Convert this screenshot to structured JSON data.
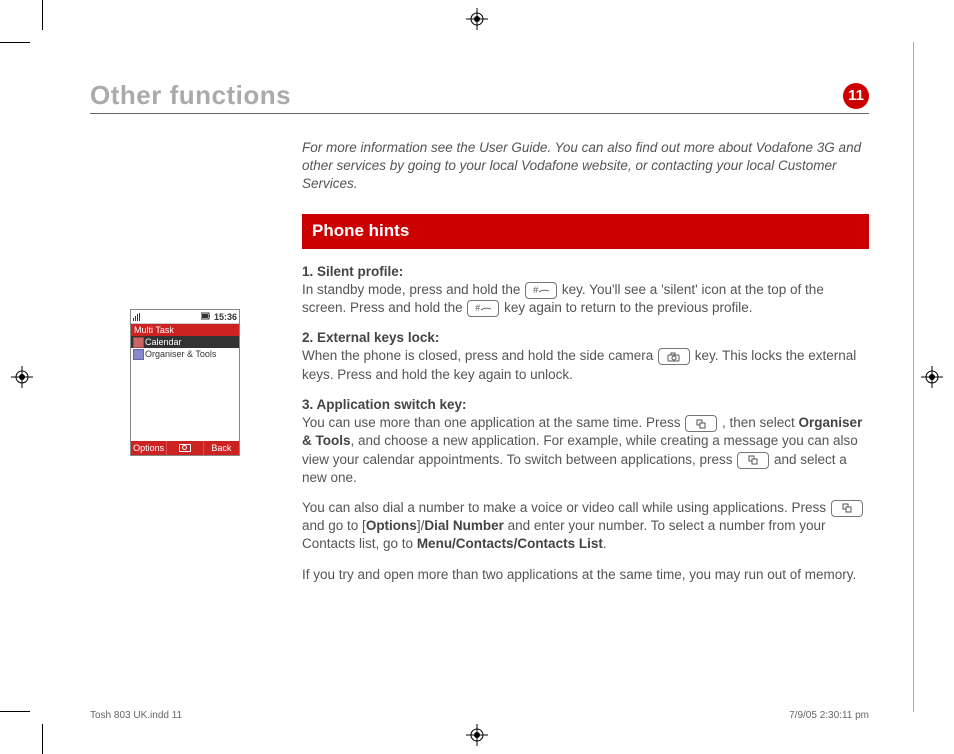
{
  "header": {
    "title": "Other functions",
    "page_number": "11"
  },
  "intro": "For more information see the User Guide. You can also find out more about Vodafone 3G and other services by going to your local Vodafone website, or contacting your local Customer Services.",
  "section_title": "Phone hints",
  "hints": {
    "h1_title": "1. Silent profile:",
    "h1_a": "In standby mode, press and hold the ",
    "h1_b": " key. You'll see a 'silent' icon at the top of the screen. Press and hold the ",
    "h1_c": " key again to return to the previous profile.",
    "h2_title": "2. External keys lock:",
    "h2_a": "When the phone is closed, press and hold the side camera ",
    "h2_b": " key. This locks the external keys. Press and hold the key again to unlock.",
    "h3_title": "3. Application switch key:",
    "h3_a": "You can use more than one application at the same time. Press ",
    "h3_b": " , then select ",
    "h3_b_bold": "Organiser & Tools",
    "h3_c": ", and choose a new application. For example, while creating a message you can also view your calendar appointments. To switch between applications, press ",
    "h3_d": " and select a new one.",
    "p4_a": "You can also dial a number to make a voice or video call while using applications. Press ",
    "p4_b": " and go to [",
    "p4_b_bold1": "Options",
    "p4_b_mid": "]/",
    "p4_b_bold2": "Dial Number",
    "p4_c": " and enter your number. To select a number from your Contacts list, go to ",
    "p4_c_bold": "Menu/Contacts/Contacts List",
    "p4_d": ".",
    "p5": "If you try and open more than two applications at the same time, you may run out of memory."
  },
  "key_labels": {
    "hash": "#",
    "camera": "camera",
    "switch": "switch"
  },
  "phone": {
    "time": "15:36",
    "title": "Multi Task",
    "items": [
      "Calendar",
      "Organiser & Tools"
    ],
    "soft_left": "Options",
    "soft_right": "Back"
  },
  "footer": {
    "left": "Tosh 803 UK.indd   11",
    "right": "7/9/05   2:30:11 pm"
  }
}
